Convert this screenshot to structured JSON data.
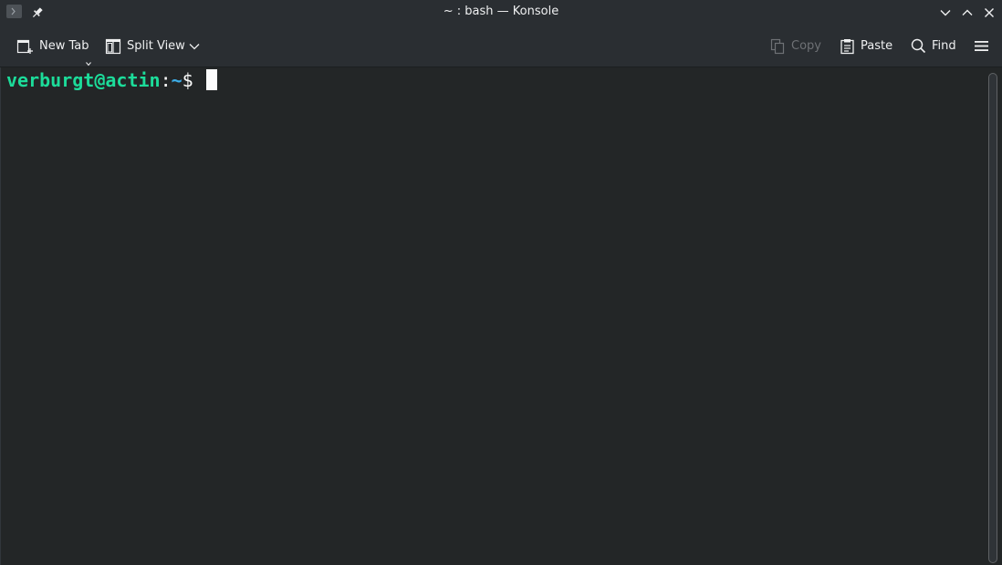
{
  "window": {
    "title": "~ : bash — Konsole"
  },
  "toolbar": {
    "new_tab_label": "New Tab",
    "split_view_label": "Split View",
    "copy_label": "Copy",
    "paste_label": "Paste",
    "find_label": "Find"
  },
  "terminal": {
    "user_host": "verburgt@actin",
    "colon": ":",
    "path": "~",
    "dollar": "$ "
  },
  "colors": {
    "user_host": "#1cdc9a",
    "path": "#3daee9",
    "background": "#232627",
    "chrome": "#2a2e32"
  },
  "icons": {
    "app": "terminal-app-icon",
    "pin": "pin-icon",
    "minimize": "chevron-down-icon",
    "maximize": "chevron-up-icon",
    "close": "close-icon",
    "new_tab": "new-tab-icon",
    "split_view": "split-view-icon",
    "copy": "copy-icon",
    "paste": "paste-icon",
    "find": "search-icon",
    "menu": "hamburger-menu-icon"
  }
}
